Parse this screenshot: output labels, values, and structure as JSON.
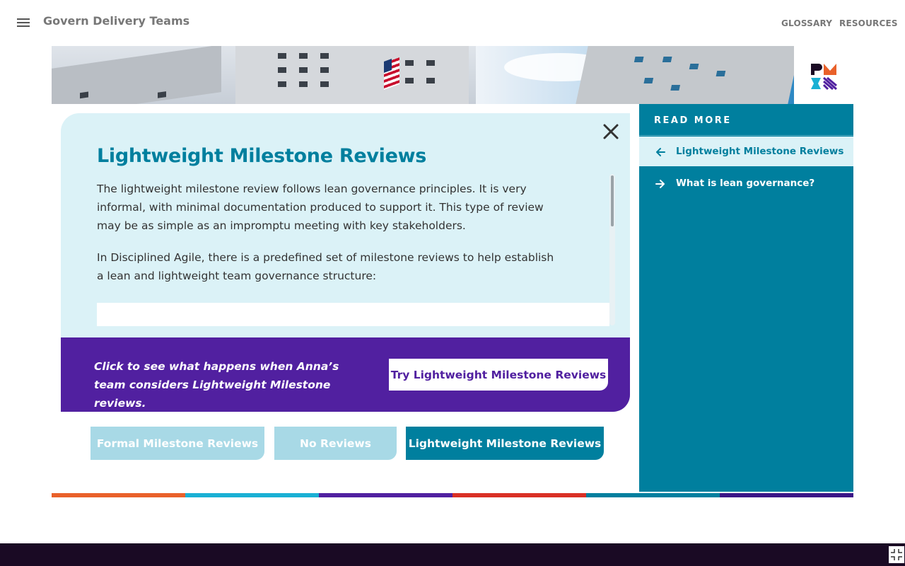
{
  "header": {
    "app_title": "Govern Delivery Teams",
    "nav": {
      "glossary": "GLOSSARY",
      "resources": "RESOURCES"
    },
    "menu_icon": "hamburger-icon"
  },
  "logo": {
    "text": "PMI",
    "colors": [
      "#e9612a",
      "#1ab0d4",
      "#5120a0",
      "#1a0a24"
    ]
  },
  "card": {
    "title": "Lightweight Milestone Reviews",
    "paragraphs": [
      "The lightweight milestone review follows lean governance principles. It is very informal, with minimal documentation produced to support it. This type of review may be as simple as an impromptu meeting with key stakeholders.",
      "In Disciplined Agile, there is a predefined set of milestone reviews to help establish a lean and lightweight team governance structure:"
    ],
    "close_icon": "close-icon"
  },
  "cta": {
    "text": "Click to see what happens when Anna’s team considers Lightweight Milestone reviews.",
    "button_label": "Try Lightweight Milestone Reviews"
  },
  "options": [
    {
      "label": "Formal Milestone Reviews",
      "selected": false
    },
    {
      "label": "No Reviews",
      "selected": false
    },
    {
      "label": "Lightweight Milestone Reviews",
      "selected": true
    }
  ],
  "read_more": {
    "title": "READ MORE",
    "items": [
      {
        "label": "Lightweight Milestone Reviews",
        "icon": "arrow-left-icon",
        "active": true
      },
      {
        "label": "What is lean governance?",
        "icon": "arrow-right-icon",
        "active": false
      }
    ]
  },
  "colors": {
    "accent": "#007f9e",
    "purple": "#5120a0",
    "light_panel": "#dbf2f7",
    "stripe": [
      "#e9612a",
      "#1ab0d4",
      "#5120a0",
      "#d93025",
      "#007f9e",
      "#3b1587"
    ]
  },
  "footer": {
    "fullscreen_icon": "exit-fullscreen-icon"
  }
}
